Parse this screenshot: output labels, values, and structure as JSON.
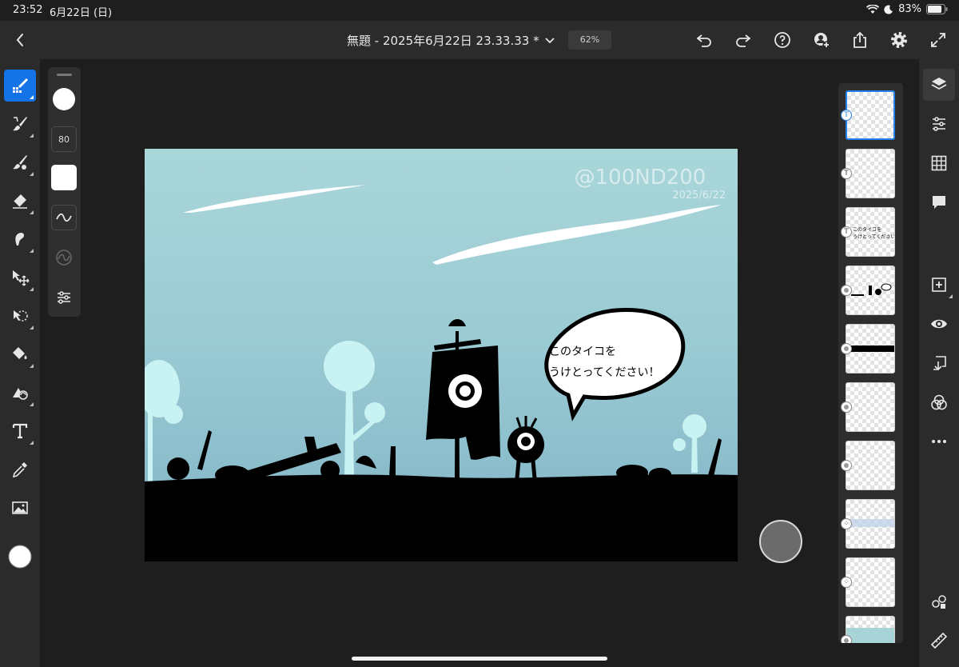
{
  "status_bar": {
    "time": "23:52",
    "date": "6月22日 (日)",
    "battery": "83%"
  },
  "header": {
    "title": "無題 - 2025年6月22日 23.33.33 *",
    "zoom": "62%"
  },
  "left_tools": [
    "brush-select-tool",
    "paint-brush-tool",
    "mixer-brush-tool",
    "eraser-tool",
    "smudge-tool",
    "move-transform-tool",
    "lasso-select-tool",
    "fill-tool",
    "liquify-tool",
    "text-tool",
    "eyedropper-tool",
    "image-place-tool",
    "color-swatch"
  ],
  "tool_options": {
    "brush_size": "80"
  },
  "artwork": {
    "watermark": "@100ND200",
    "date": "2025/6/22",
    "speech_line1": "このタイコを",
    "speech_line2": "うけとってください！",
    "sky_top": "#a8d5d8",
    "sky_bottom": "#7fb4c6"
  },
  "layers": [
    {
      "type": "text",
      "selected": true
    },
    {
      "type": "text",
      "selected": false
    },
    {
      "type": "text",
      "selected": false,
      "preview_line1": "このタイコを",
      "preview_line2": "うけとってください！"
    },
    {
      "type": "pixel",
      "selected": false
    },
    {
      "type": "pixel",
      "selected": false
    },
    {
      "type": "pixel",
      "selected": false
    },
    {
      "type": "pixel",
      "selected": false
    },
    {
      "type": "group",
      "selected": false
    },
    {
      "type": "group",
      "selected": false
    },
    {
      "type": "pixel",
      "selected": false
    }
  ],
  "colors": {
    "accent": "#1473e6",
    "panel": "#2b2b2b",
    "canvas": "#1e1e1e"
  }
}
